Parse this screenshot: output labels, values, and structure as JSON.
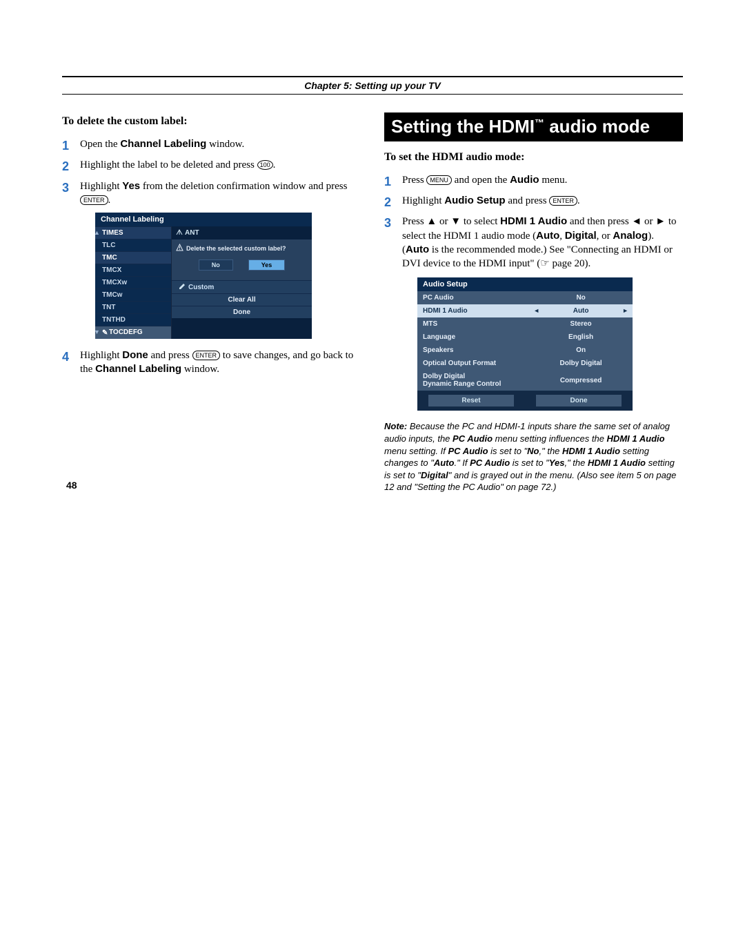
{
  "chapter": "Chapter 5: Setting up your TV",
  "page_number": "48",
  "left": {
    "heading": "To delete the custom label:",
    "steps": [
      {
        "num": "1",
        "pre": "Open the ",
        "bold": "Channel Labeling",
        "post": " window."
      },
      {
        "num": "2",
        "pre": "Highlight the label to be deleted and press ",
        "icon": "100",
        "post": "."
      },
      {
        "num": "3",
        "pre": "Highlight ",
        "bold": "Yes",
        "post": " from the deletion confirmation window and press ",
        "icon": "ENTER",
        "post2": "."
      },
      {
        "num": "4",
        "pre": "Highlight ",
        "bold": "Done",
        "mid": " and press ",
        "icon": "ENTER",
        "post": " to save changes, and go back to the ",
        "bold2": "Channel Labeling",
        "post2": " window."
      }
    ],
    "mock": {
      "title": "Channel Labeling",
      "channels": [
        "TIMES",
        "TLC",
        "TMC",
        "TMCX",
        "TMCXw",
        "TMCw",
        "TNT",
        "TNTHD",
        "TOCDEFG"
      ],
      "ant": "ANT",
      "dialog_msg": "Delete the selected custom label?",
      "no": "No",
      "yes": "Yes",
      "custom": "Custom",
      "clear_all": "Clear All",
      "done": "Done"
    }
  },
  "right": {
    "title_pre": "Setting the HDMI",
    "title_post": " audio mode",
    "heading": "To set the HDMI audio mode:",
    "steps": {
      "s1": {
        "num": "1",
        "a": "Press ",
        "icon": "MENU",
        "b": " and open the ",
        "bold": "Audio",
        "c": " menu."
      },
      "s2": {
        "num": "2",
        "a": "Highlight ",
        "bold": "Audio Setup",
        "b": " and press ",
        "icon": "ENTER",
        "c": "."
      },
      "s3": {
        "num": "3",
        "a": "Press ▲ or ▼ to select ",
        "bold1": "HDMI 1 Audio",
        "b": " and then press ◄ or ► to select the HDMI 1 audio mode (",
        "bold2": "Auto",
        "c": ", ",
        "bold3": "Digital",
        "d": ", or ",
        "bold4": "Analog",
        "e": "). (",
        "bold5": "Auto",
        "f": " is the recommended mode.) See \"Connecting an HDMI or DVI device to the HDMI input\" (☞ page 20)."
      }
    },
    "mock": {
      "title": "Audio Setup",
      "rows": [
        {
          "label": "PC Audio",
          "value": "No",
          "kind": "dk"
        },
        {
          "label": "HDMI 1 Audio",
          "value": "Auto",
          "kind": "lt"
        },
        {
          "label": "MTS",
          "value": "Stereo",
          "kind": "dk"
        },
        {
          "label": "Language",
          "value": "English",
          "kind": "dk"
        },
        {
          "label": "Speakers",
          "value": "On",
          "kind": "dk"
        },
        {
          "label": "Optical Output Format",
          "value": "Dolby Digital",
          "kind": "dk"
        },
        {
          "label": "Dolby Digital\nDynamic Range Control",
          "value": "Compressed",
          "kind": "dk"
        }
      ],
      "reset": "Reset",
      "done": "Done"
    },
    "note": {
      "label": "Note:",
      "t1": " Because the PC and HDMI-1 inputs share the same set of analog audio inputs, the ",
      "b1": "PC Audio",
      "t2": " menu setting influences the ",
      "b2": "HDMI 1 Audio",
      "t3": " menu setting. If ",
      "b3": "PC Audio",
      "t4": " is set to \"",
      "b4": "No",
      "t5": ",\" the ",
      "b5": "HDMI 1 Audio",
      "t6": " setting changes to \"",
      "b6": "Auto",
      "t7": ".\" If ",
      "b7": "PC Audio",
      "t8": " is set to \"",
      "b8": "Yes",
      "t9": ",\" the ",
      "b9": "HDMI 1 Audio",
      "t10": " setting is set to \"",
      "b10": "Digital",
      "t11": "\" and is grayed out in the menu. (Also see item 5 on page 12 and \"Setting the PC Audio\" on page 72.)"
    }
  }
}
